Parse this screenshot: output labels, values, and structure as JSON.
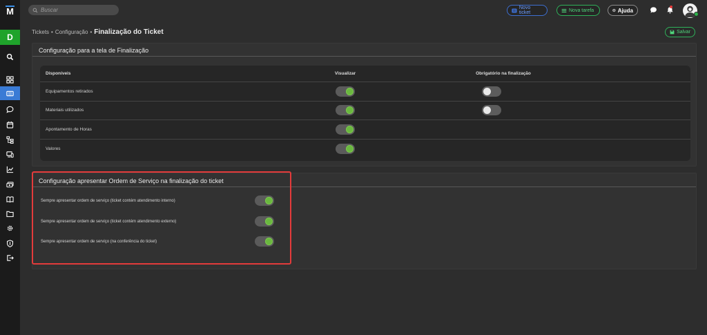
{
  "app": {
    "logo_text": "M",
    "workspace_letter": "D"
  },
  "sidebar": {
    "items": [
      {
        "name": "search-icon",
        "active": false
      },
      {
        "name": "dashboard-icon",
        "active": false
      },
      {
        "name": "ticket-icon",
        "active": true
      },
      {
        "name": "chat-icon",
        "active": false
      },
      {
        "name": "calendar-icon",
        "active": false
      },
      {
        "name": "hierarchy-icon",
        "active": false
      },
      {
        "name": "devices-icon",
        "active": false
      },
      {
        "name": "chart-icon",
        "active": false
      },
      {
        "name": "money-icon",
        "active": false
      },
      {
        "name": "book-icon",
        "active": false
      },
      {
        "name": "folder-icon",
        "active": false
      },
      {
        "name": "gear-icon",
        "active": false
      },
      {
        "name": "shield-icon",
        "active": false
      },
      {
        "name": "exit-icon",
        "active": false
      }
    ]
  },
  "topbar": {
    "search_placeholder": "Buscar",
    "new_ticket_label": "Novo ticket",
    "new_task_label": "Nova tarefa",
    "help_label": "Ajuda"
  },
  "breadcrumb": {
    "items": [
      "Tickets",
      "Configuração"
    ],
    "separator": "•",
    "current": "Finalização do Ticket"
  },
  "actions": {
    "save_label": "Salvar"
  },
  "panel1": {
    "title": "Configuração para a tela de Finalização",
    "headers": {
      "col1": "Disponíveis",
      "col2": "Visualizar",
      "col3": "Obrigatório na finalização"
    },
    "rows": [
      {
        "label": "Equipamentos retirados",
        "visualizar": true,
        "obrigatorio": false
      },
      {
        "label": "Materiais utilizados",
        "visualizar": true,
        "obrigatorio": false
      },
      {
        "label": "Apontamento de Horas",
        "visualizar": true,
        "obrigatorio": null
      },
      {
        "label": "Valores",
        "visualizar": true,
        "obrigatorio": null
      }
    ]
  },
  "panel2": {
    "title": "Configuração apresentar Ordem de Serviço na finalização do ticket",
    "rows": [
      {
        "label": "Sempre apresentar ordem de serviço (ticket contém atendimento interno)",
        "enabled": true
      },
      {
        "label": "Sempre apresentar ordem de serviço (ticket contém atendimento externo)",
        "enabled": true
      },
      {
        "label": "Sempre apresentar ordem de serviço (na conferência do ticket)",
        "enabled": true
      }
    ]
  },
  "colors": {
    "accent_blue": "#3a7bd5",
    "accent_green": "#2fb25a",
    "toggle_on": "#6ab83f",
    "highlight_red": "#e43b3b"
  }
}
